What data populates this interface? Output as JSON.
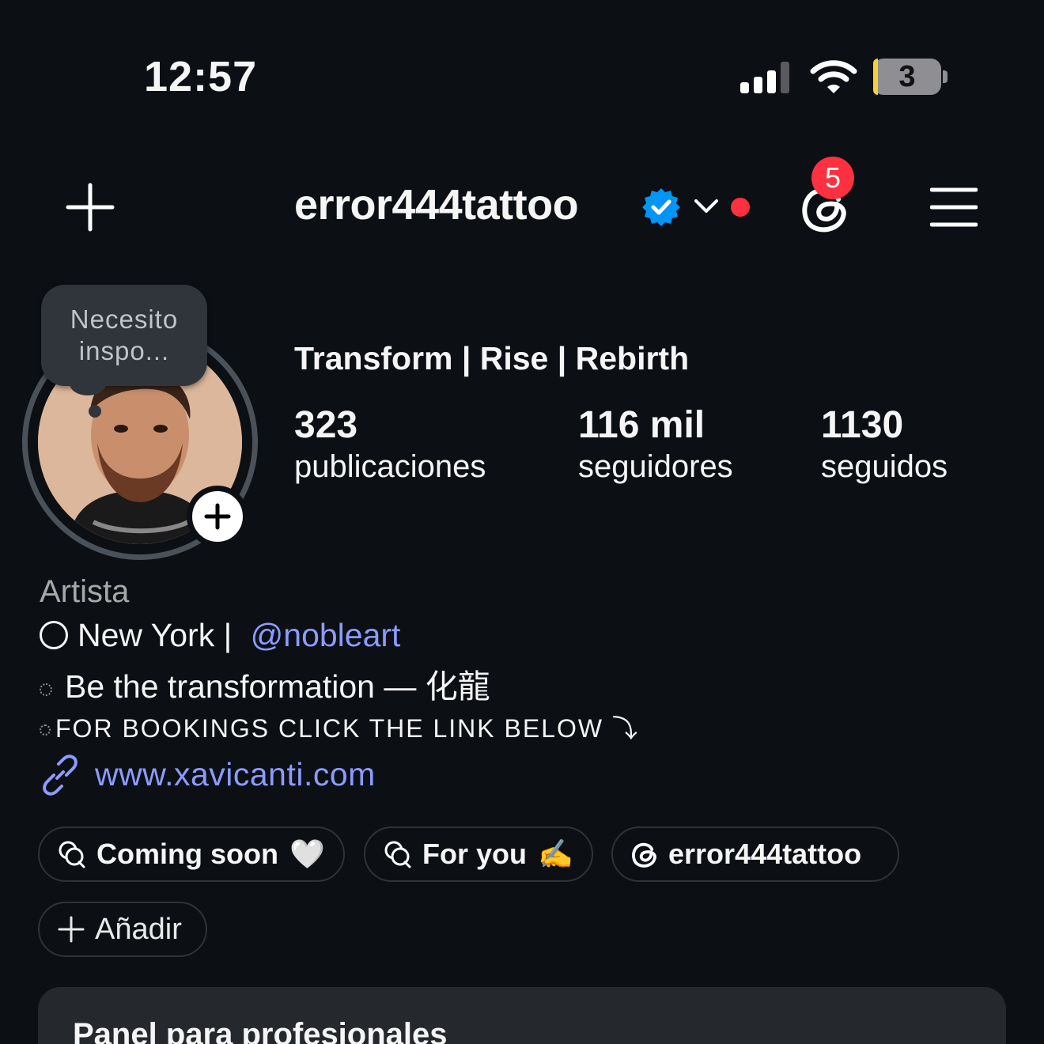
{
  "status_bar": {
    "time": "12:57",
    "battery": "3",
    "icons": [
      "signal-icon",
      "wifi-icon",
      "battery-icon"
    ]
  },
  "header": {
    "username": "error444tattoo",
    "notification_count": "5",
    "icons": [
      "plus-icon",
      "verified-badge-icon",
      "chevron-down-icon",
      "threads-icon",
      "menu-icon"
    ]
  },
  "note": {
    "text": "Necesito inspo..."
  },
  "profile": {
    "display_name": "Transform | Rise | Rebirth",
    "stats": [
      {
        "value": "323",
        "label": "publicaciones"
      },
      {
        "value": "116 mil",
        "label": "seguidores"
      },
      {
        "value": "1130",
        "label": "seguidos"
      }
    ]
  },
  "bio": {
    "category": "Artista",
    "line1_text": "New York | ",
    "mention": "@nobleart",
    "line2": "Be the transformation —  化龍",
    "line3": "FOR BOOKINGS CLICK THE LINK BELOW ⤵︎",
    "link": "www.xavicanti.com"
  },
  "pills": [
    {
      "label": "Coming soon",
      "emoji": "🤍",
      "icon": "chat-bubbles-icon"
    },
    {
      "label": "For you",
      "emoji": "✍️",
      "icon": "chat-bubbles-icon"
    },
    {
      "label": "error444tattoo",
      "emoji": "",
      "icon": "threads-icon"
    },
    {
      "label": "Añadir",
      "emoji": "",
      "icon": "plus-icon"
    }
  ],
  "panel": {
    "title": "Panel para profesionales"
  },
  "colors": {
    "background": "#0c1014",
    "link": "#8c9bff",
    "badge_red": "#ff3040",
    "verified_blue": "#0095f6"
  }
}
